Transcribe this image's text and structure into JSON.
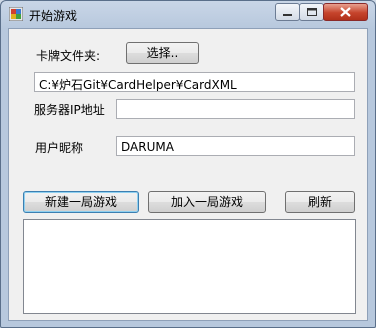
{
  "window": {
    "title": "开始游戏"
  },
  "form": {
    "card_folder_label": "卡牌文件夹:",
    "choose_button": "选择..",
    "card_folder_path": "C:¥炉石Git¥CardHelper¥CardXML",
    "server_ip_label": "服务器IP地址",
    "server_ip_value": "",
    "nickname_label": "用户昵称",
    "nickname_value": "DARUMA"
  },
  "actions": {
    "new_game": "新建一局游戏",
    "join_game": "加入一局游戏",
    "refresh": "刷新"
  },
  "game_list": {
    "items": []
  }
}
